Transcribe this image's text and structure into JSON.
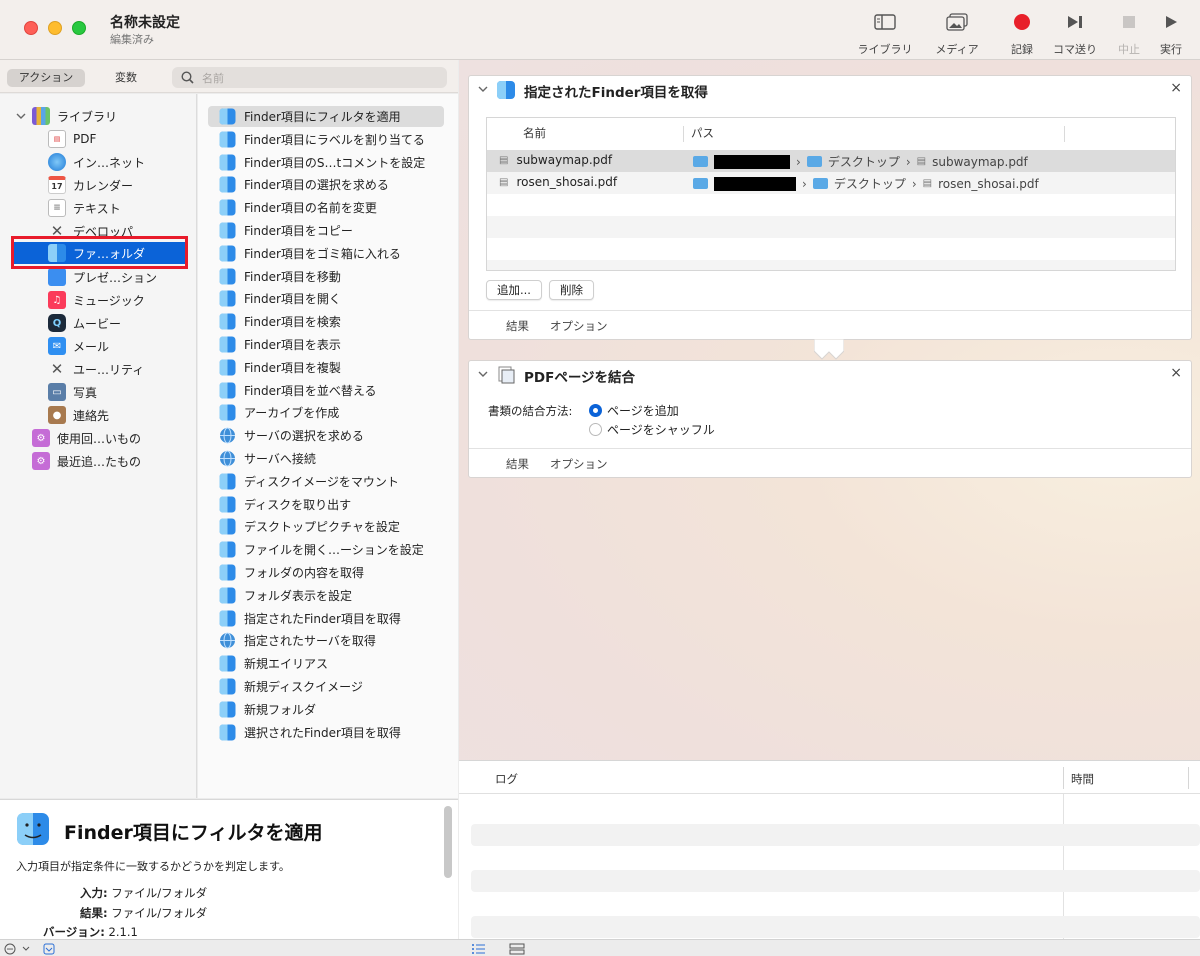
{
  "window": {
    "title": "名称未設定",
    "subtitle": "編集済み"
  },
  "toolbar": {
    "library": "ライブラリ",
    "media": "メディア",
    "record": "記録",
    "step": "コマ送り",
    "stop": "中止",
    "run": "実行",
    "record_color": "#e8202a"
  },
  "left_top": {
    "actions_tab": "アクション",
    "variables_tab": "変数",
    "search_placeholder": "名前"
  },
  "library": {
    "root": "ライブラリ",
    "items": [
      "PDF",
      "イン…ネット",
      "カレンダー",
      "テキスト",
      "デベロッパ",
      "ファ…ォルダ",
      "プレゼ…ション",
      "ミュージック",
      "ムービー",
      "メール",
      "ユー…リティ",
      "写真",
      "連絡先"
    ],
    "smart": [
      "使用回…いもの",
      "最近追…たもの"
    ],
    "selected": "ファ…ォルダ"
  },
  "actions": [
    "Finder項目にフィルタを適用",
    "Finder項目にラベルを割り当てる",
    "Finder項目のS…tコメントを設定",
    "Finder項目の選択を求める",
    "Finder項目の名前を変更",
    "Finder項目をコピー",
    "Finder項目をゴミ箱に入れる",
    "Finder項目を移動",
    "Finder項目を開く",
    "Finder項目を検索",
    "Finder項目を表示",
    "Finder項目を複製",
    "Finder項目を並べ替える",
    "アーカイブを作成",
    "サーバの選択を求める",
    "サーバへ接続",
    "ディスクイメージをマウント",
    "ディスクを取り出す",
    "デスクトップピクチャを設定",
    "ファイルを開く…ーションを設定",
    "フォルダの内容を取得",
    "フォルダ表示を設定",
    "指定されたFinder項目を取得",
    "指定されたサーバを取得",
    "新規エイリアス",
    "新規ディスクイメージ",
    "新規フォルダ",
    "選択されたFinder項目を取得"
  ],
  "description": {
    "title": "Finder項目にフィルタを適用",
    "text": "入力項目が指定条件に一致するかどうかを判定します。",
    "input_label": "入力:",
    "input_value": "ファイル/フォルダ",
    "result_label": "結果:",
    "result_value": "ファイル/フォルダ",
    "version_label": "バージョン:",
    "version_value": "2.1.1"
  },
  "card1": {
    "title": "指定されたFinder項目を取得",
    "col_name": "名前",
    "col_path": "パス",
    "rows": [
      {
        "name": "subwaymap.pdf",
        "folder": "デスクトップ",
        "file": "subwaymap.pdf"
      },
      {
        "name": "rosen_shosai.pdf",
        "folder": "デスクトップ",
        "file": "rosen_shosai.pdf"
      }
    ],
    "add_button": "追加...",
    "remove_button": "削除",
    "results": "結果",
    "options": "オプション",
    "close": "×"
  },
  "card2": {
    "title": "PDFページを結合",
    "method_label": "書類の結合方法:",
    "option_append": "ページを追加",
    "option_shuffle": "ページをシャッフル",
    "selected_option": "ページを追加",
    "results": "結果",
    "options": "オプション",
    "close": "×"
  },
  "log": {
    "col_log": "ログ",
    "col_time": "時間"
  }
}
